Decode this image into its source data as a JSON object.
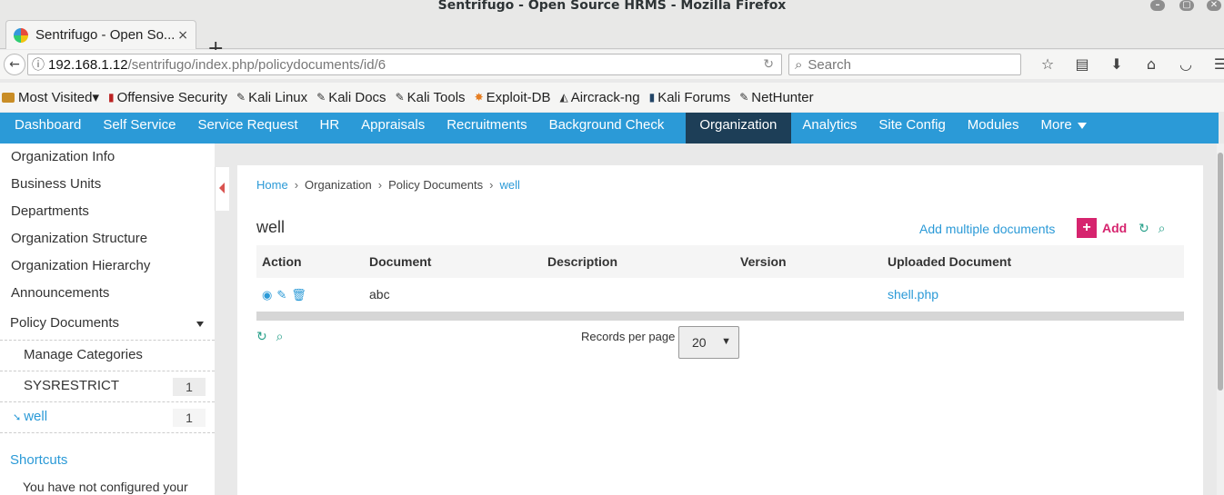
{
  "window": {
    "title": "Sentrifugo - Open Source HRMS - Mozilla Firefox",
    "controls": [
      "–",
      "▢",
      "✕"
    ]
  },
  "browser": {
    "tab_title": "Sentrifugo - Open So...",
    "tab_close": "×",
    "new_tab": "+",
    "url_host": "192.168.1.12",
    "url_path": "/sentrifugo/index.php/policydocuments/id/6",
    "search_placeholder": "Search",
    "bookmarks": [
      {
        "label": "Most Visited",
        "icon": "folder-icon",
        "suffix": "▾"
      },
      {
        "label": "Offensive Security",
        "icon": "offsec-icon"
      },
      {
        "label": "Kali Linux",
        "icon": "kali-icon"
      },
      {
        "label": "Kali Docs",
        "icon": "kali-icon"
      },
      {
        "label": "Kali Tools",
        "icon": "kali-icon"
      },
      {
        "label": "Exploit-DB",
        "icon": "exploitdb-icon"
      },
      {
        "label": "Aircrack-ng",
        "icon": "aircrack-icon"
      },
      {
        "label": "Kali Forums",
        "icon": "kali-forums-icon"
      },
      {
        "label": "NetHunter",
        "icon": "kali-icon"
      }
    ]
  },
  "nav": {
    "items": [
      "Dashboard",
      "Self Service",
      "Service Request",
      "HR",
      "Appraisals",
      "Recruitments",
      "Background Check",
      "Organization",
      "Analytics",
      "Site Config",
      "Modules",
      "More"
    ],
    "active": "Organization",
    "accent": "#2b9ad7",
    "active_color": "#1d3e57"
  },
  "sidebar": {
    "links": [
      "Organization Info",
      "Business Units",
      "Departments",
      "Organization Structure",
      "Organization Hierarchy",
      "Announcements"
    ],
    "policy_documents": "Policy Documents",
    "sub_items": [
      {
        "label": "Manage Categories",
        "count": ""
      },
      {
        "label": "SYSRESTRICT",
        "count": "1"
      },
      {
        "label": "well",
        "count": "1",
        "active": true
      }
    ],
    "shortcuts": "Shortcuts",
    "shortcuts_message": "You have not configured your"
  },
  "breadcrumb": [
    "Home",
    "Organization",
    "Policy Documents",
    "well"
  ],
  "page": {
    "title": "well",
    "add_multiple": "Add multiple documents",
    "add": "Add",
    "add_symbol": "+"
  },
  "table": {
    "columns": [
      "Action",
      "Document",
      "Description",
      "Version",
      "Uploaded Document"
    ],
    "rows": [
      {
        "document": "abc",
        "description": "",
        "version": "",
        "uploaded": "shell.php"
      }
    ]
  },
  "pager": {
    "records_label": "Records per page",
    "records_value": "20"
  }
}
